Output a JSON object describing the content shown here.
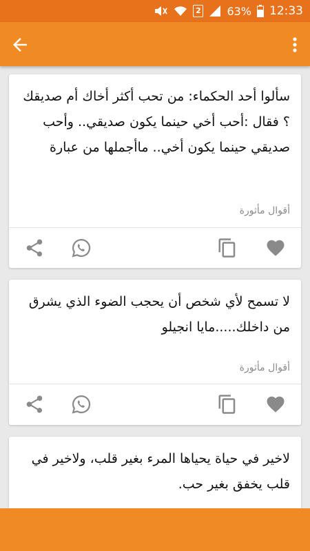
{
  "status_bar": {
    "battery_percent": "63%",
    "time": "12:33",
    "sim_slot": "2",
    "icons": [
      "mute-icon",
      "wifi-icon",
      "sim-2-icon",
      "signal-icon",
      "battery-icon"
    ]
  },
  "app_bar": {
    "back_icon": "arrow-back-icon",
    "menu_icon": "more-vert-icon"
  },
  "colors": {
    "status_bar": "#e8721c",
    "app_bar": "#f08a24",
    "background": "#e9e9e9",
    "action_icon": "#8a8a8a"
  },
  "cards": [
    {
      "quote": "سألوا أحد الحكماء: من تحب أكثر أخاك أم صديقك ؟ فقال :أحب أخي حينما يكون صديقي.. وأحب صديقي حينما  يكون أخي.. ماأجملها من عبارة",
      "category": "أقوال مأثورة",
      "actions": [
        "favorite-icon",
        "copy-icon",
        "whatsapp-icon",
        "share-icon"
      ]
    },
    {
      "quote": "لا تسمح لأي شخص أن يحجب الضوء الذي يشرق من داخلك.....مايا انجيلو",
      "category": "أقوال مأثورة",
      "actions": [
        "favorite-icon",
        "copy-icon",
        "whatsapp-icon",
        "share-icon"
      ]
    },
    {
      "quote": "لاخير في حياة يحياها المرء بغير قلب، ولاخير في قلب يخفق بغير حب.",
      "category": "",
      "actions": []
    }
  ]
}
